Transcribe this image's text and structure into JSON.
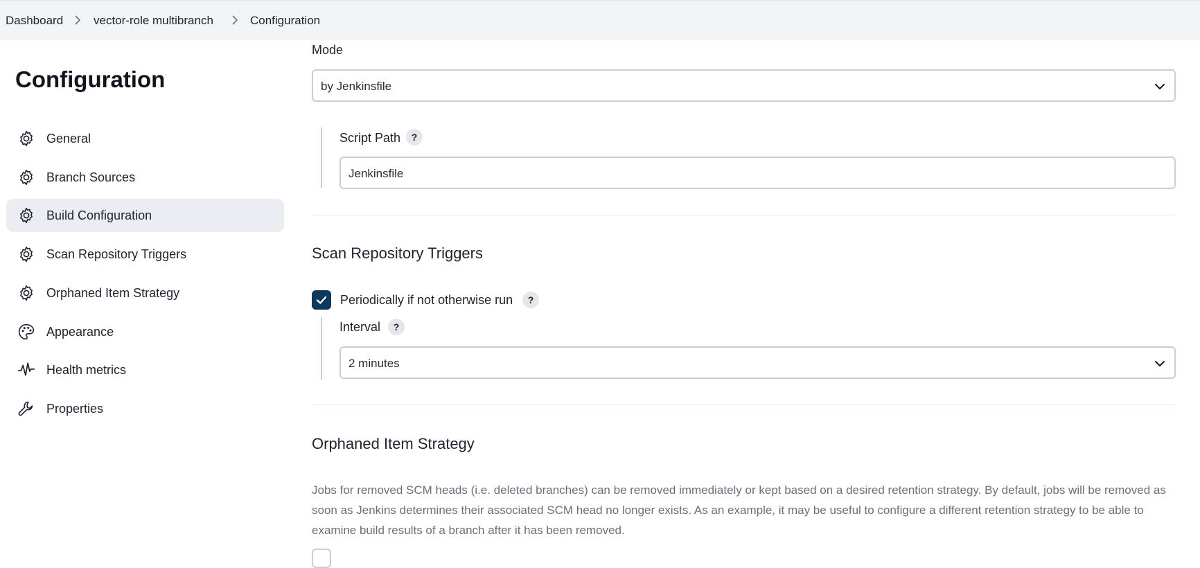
{
  "breadcrumb": {
    "items": [
      "Dashboard",
      "vector-role multibranch",
      "Configuration"
    ]
  },
  "sidebar": {
    "title": "Configuration",
    "items": [
      {
        "label": "General",
        "icon": "gear-icon"
      },
      {
        "label": "Branch Sources",
        "icon": "gear-icon"
      },
      {
        "label": "Build Configuration",
        "icon": "gear-icon",
        "active": true
      },
      {
        "label": "Scan Repository Triggers",
        "icon": "gear-icon"
      },
      {
        "label": "Orphaned Item Strategy",
        "icon": "gear-icon"
      },
      {
        "label": "Appearance",
        "icon": "palette-icon"
      },
      {
        "label": "Health metrics",
        "icon": "pulse-icon"
      },
      {
        "label": "Properties",
        "icon": "wrench-icon"
      }
    ]
  },
  "build_config": {
    "mode_label": "Mode",
    "mode_value": "by Jenkinsfile",
    "script_path_label": "Script Path",
    "script_path_value": "Jenkinsfile",
    "help_glyph": "?"
  },
  "scan_triggers": {
    "title": "Scan Repository Triggers",
    "periodic_label": "Periodically if not otherwise run",
    "periodic_checked": true,
    "interval_label": "Interval",
    "interval_value": "2 minutes"
  },
  "orphaned": {
    "title": "Orphaned Item Strategy",
    "description": "Jobs for removed SCM heads (i.e. deleted branches) can be removed immediately or kept based on a desired retention strategy. By default, jobs will be removed as soon as Jenkins determines their associated SCM head no longer exists. As an example, it may be useful to configure a different retention strategy to be able to examine build results of a branch after it has been removed."
  },
  "colors": {
    "accent": "#0b3a5e",
    "active_nav_bg": "#ecedf2",
    "topbar_bg": "#f3f4f6"
  }
}
